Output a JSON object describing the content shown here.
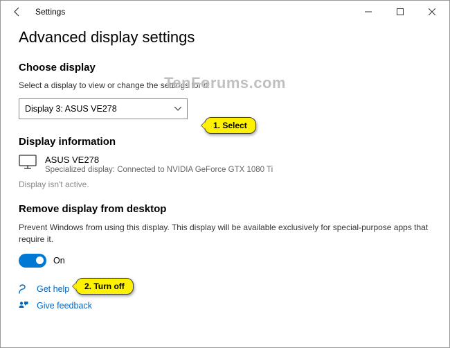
{
  "window": {
    "title": "Settings"
  },
  "page": {
    "heading": "Advanced display settings"
  },
  "choose": {
    "heading": "Choose display",
    "instruction": "Select a display to view or change the settings for it.",
    "selected": "Display 3: ASUS VE278"
  },
  "info": {
    "heading": "Display information",
    "model": "ASUS VE278",
    "detail": "Specialized display: Connected to NVIDIA GeForce GTX 1080 Ti",
    "inactive": "Display isn't active."
  },
  "remove": {
    "heading": "Remove display from desktop",
    "description": "Prevent Windows from using this display. This display will be available exclusively for special-purpose apps that require it.",
    "state": "On"
  },
  "links": {
    "help": "Get help",
    "feedback": "Give feedback"
  },
  "callouts": {
    "select": "1.  Select",
    "turnoff": "2.  Turn off"
  },
  "watermark": "TenForums.com"
}
